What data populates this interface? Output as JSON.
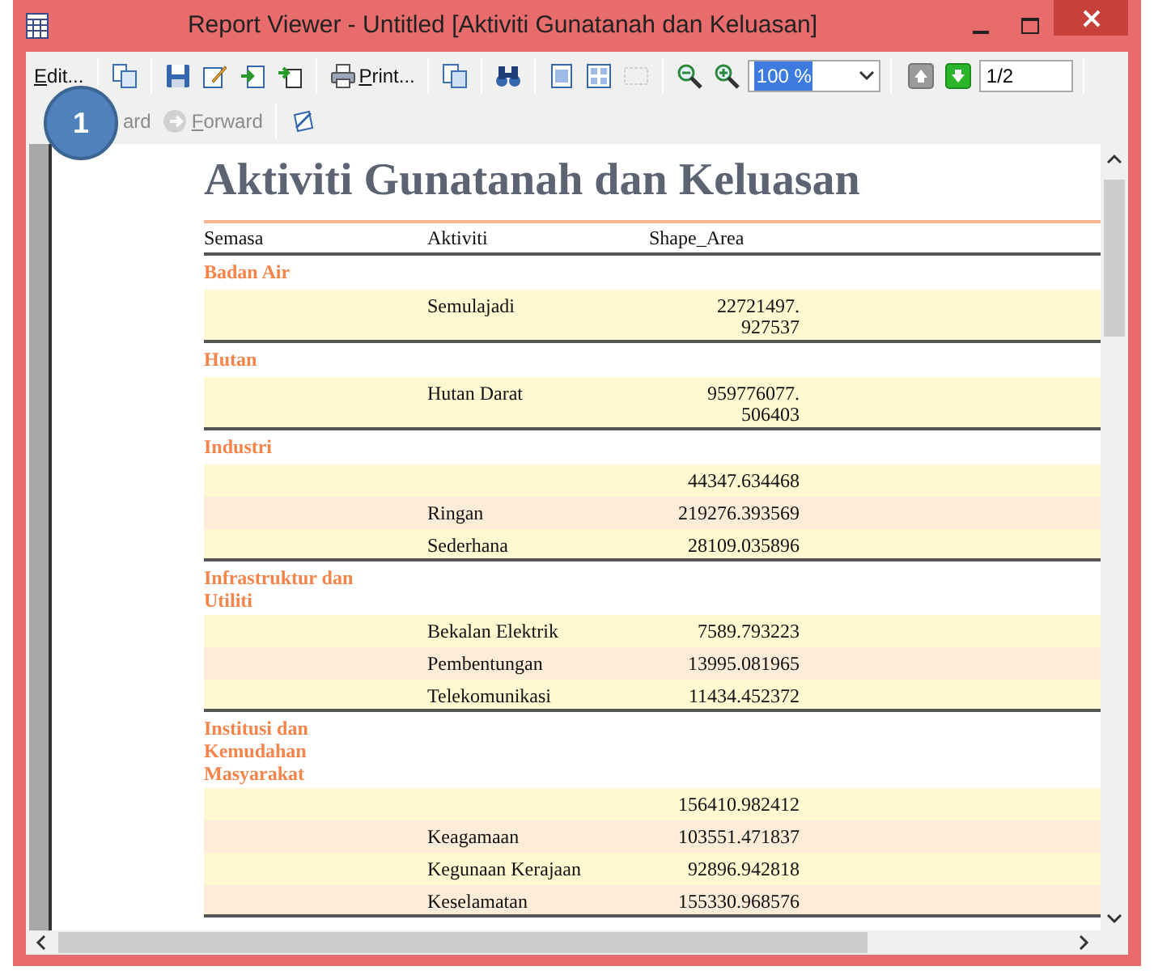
{
  "window": {
    "title": "Report Viewer - Untitled [Aktiviti Gunatanah dan Keluasan]"
  },
  "toolbar": [
    {
      "kind": "text",
      "label": "Edit...",
      "accel": true
    },
    {
      "kind": "separator"
    },
    {
      "kind": "icon",
      "disabled": false
    },
    {
      "kind": "separator"
    },
    {
      "kind": "icon",
      "disabled": false
    },
    {
      "kind": "icon",
      "disabled": false
    },
    {
      "kind": "icon",
      "disabled": false
    },
    {
      "kind": "icon",
      "disabled": false
    },
    {
      "kind": "separator"
    },
    {
      "kind": "icon_text",
      "label": "Print...",
      "accel": true
    },
    {
      "kind": "separator"
    },
    {
      "kind": "icon",
      "disabled": false
    },
    {
      "kind": "separator"
    },
    {
      "kind": "icon",
      "disabled": false
    },
    {
      "kind": "separator"
    },
    {
      "kind": "icon",
      "disabled": false
    },
    {
      "kind": "icon",
      "disabled": false
    },
    {
      "kind": "icon",
      "disabled": true
    },
    {
      "kind": "separator"
    },
    {
      "kind": "icon",
      "disabled": false
    },
    {
      "kind": "icon",
      "disabled": false
    },
    {
      "kind": "select",
      "value": "100 %",
      "text_selected": true
    },
    {
      "kind": "separator"
    },
    {
      "kind": "icon",
      "disabled": true
    },
    {
      "kind": "icon",
      "disabled": false
    },
    {
      "kind": "field",
      "value": "1/2"
    },
    {
      "kind": "separator"
    }
  ],
  "toolbar_2": [
    {
      "kind": "icon_text",
      "label": "ard",
      "accel": false,
      "disabled": true
    },
    {
      "kind": "icon_text",
      "label": "Forward",
      "accel": true,
      "disabled": true
    },
    {
      "kind": "separator"
    },
    {
      "kind": "icon",
      "disabled": false
    }
  ],
  "callout": "1",
  "report": {
    "title": "Aktiviti Gunatanah dan Keluasan",
    "columns": [
      "Semasa",
      "Aktiviti",
      "Shape_Area"
    ],
    "groups": [
      {
        "name": "Badan Air",
        "rows": [
          {
            "aktiviti": "Semulajadi",
            "shape_area": "22721497.927537"
          }
        ]
      },
      {
        "name": "Hutan",
        "rows": [
          {
            "aktiviti": "Hutan Darat",
            "shape_area": "959776077.506403"
          }
        ]
      },
      {
        "name": "Industri",
        "rows": [
          {
            "shape_area": "44347.634468"
          },
          {
            "aktiviti": "Ringan",
            "shape_area": "219276.393569"
          },
          {
            "aktiviti": "Sederhana",
            "shape_area": "28109.035896"
          }
        ]
      },
      {
        "name": "Infrastruktur dan Utiliti",
        "rows": [
          {
            "aktiviti": "Bekalan Elektrik",
            "shape_area": "7589.793223"
          },
          {
            "aktiviti": "Pembentungan",
            "shape_area": "13995.081965"
          },
          {
            "aktiviti": "Telekomunikasi",
            "shape_area": "11434.452372"
          }
        ]
      },
      {
        "name": "Institusi dan Kemudahan Masyarakat",
        "rows": [
          {
            "shape_area": "156410.982412"
          },
          {
            "aktiviti": "Keagamaan",
            "shape_area": "103551.471837"
          },
          {
            "aktiviti": "Kegunaan Kerajaan",
            "shape_area": "92896.942818"
          },
          {
            "aktiviti": "Keselamatan",
            "shape_area": "155330.968576"
          }
        ]
      }
    ]
  }
}
